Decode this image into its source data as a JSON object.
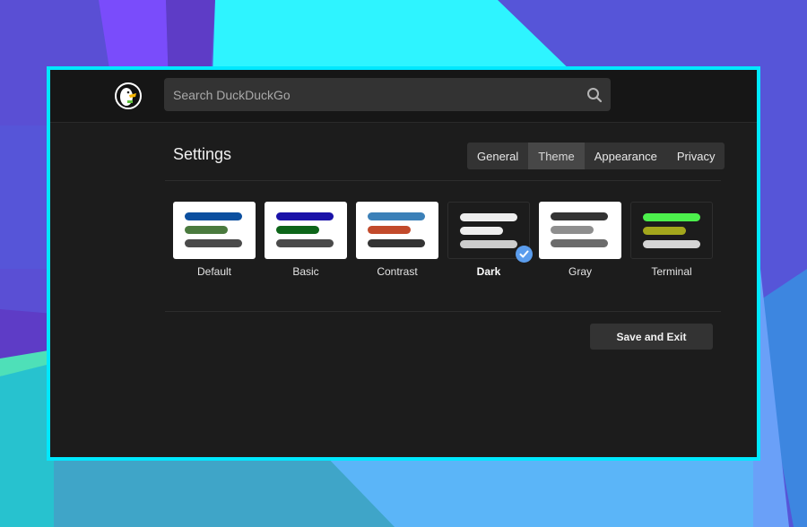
{
  "app": {
    "name": "DuckDuckGo",
    "logo_icon": "duckduckgo-logo",
    "frame_color": "#00e8ff"
  },
  "search": {
    "placeholder": "Search DuckDuckGo",
    "value": "",
    "icon": "search-icon"
  },
  "settings": {
    "title": "Settings",
    "tabs": [
      {
        "label": "General",
        "active": false
      },
      {
        "label": "Theme",
        "active": true
      },
      {
        "label": "Appearance",
        "active": false
      },
      {
        "label": "Privacy",
        "active": false
      }
    ],
    "themes": [
      {
        "label": "Default",
        "selected": false,
        "background": "#ffffff",
        "bars": [
          "#0b4f9f",
          "#4a7a3e",
          "#4a4a4a"
        ]
      },
      {
        "label": "Basic",
        "selected": false,
        "background": "#ffffff",
        "bars": [
          "#1a12a8",
          "#0d6519",
          "#4a4a4a"
        ]
      },
      {
        "label": "Contrast",
        "selected": false,
        "background": "#ffffff",
        "bars": [
          "#3b80b8",
          "#c24a2b",
          "#333333"
        ]
      },
      {
        "label": "Dark",
        "selected": true,
        "background": "#1c1c1c",
        "bars": [
          "#eeeeee",
          "#eeeeee",
          "#cccccc"
        ]
      },
      {
        "label": "Gray",
        "selected": false,
        "background": "#ffffff",
        "bars": [
          "#333333",
          "#8e8e8e",
          "#6b6b6b"
        ]
      },
      {
        "label": "Terminal",
        "selected": false,
        "background": "#1c1c1c",
        "bars": [
          "#4cf04c",
          "#a3a71c",
          "#d4d4d4"
        ]
      }
    ],
    "selected_check_color": "#5b9ded",
    "save_label": "Save and Exit"
  }
}
